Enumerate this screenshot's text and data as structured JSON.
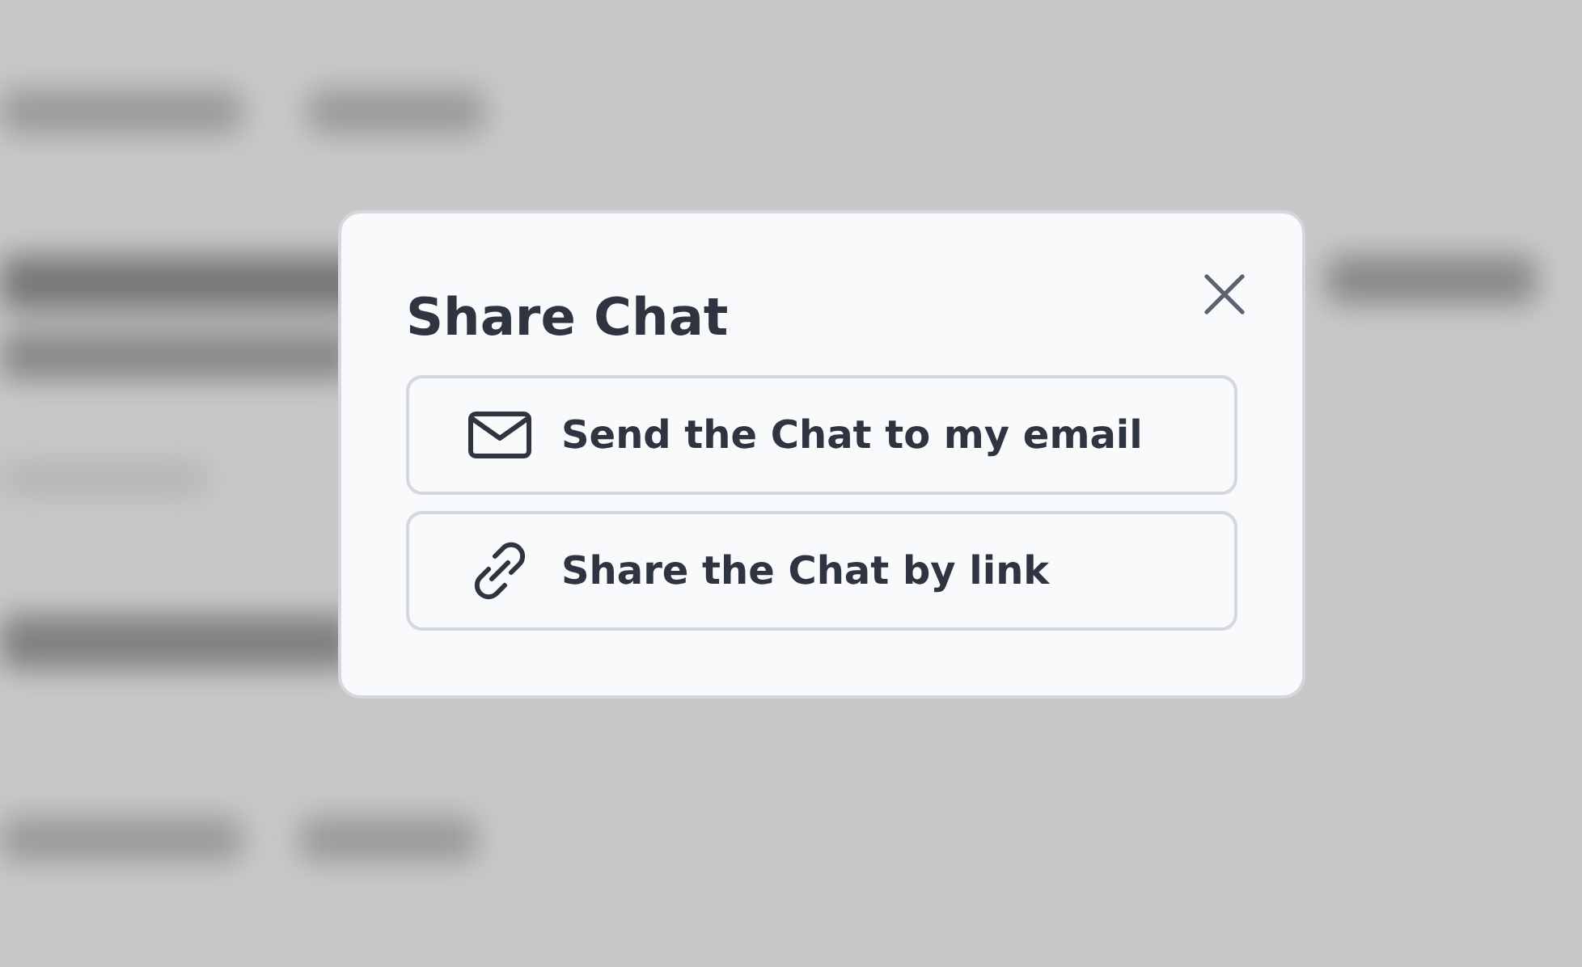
{
  "dialog": {
    "title": "Share Chat",
    "options": [
      {
        "kind": "email",
        "label": "Send the Chat to my email"
      },
      {
        "kind": "link",
        "label": "Share the Chat by link"
      }
    ]
  }
}
